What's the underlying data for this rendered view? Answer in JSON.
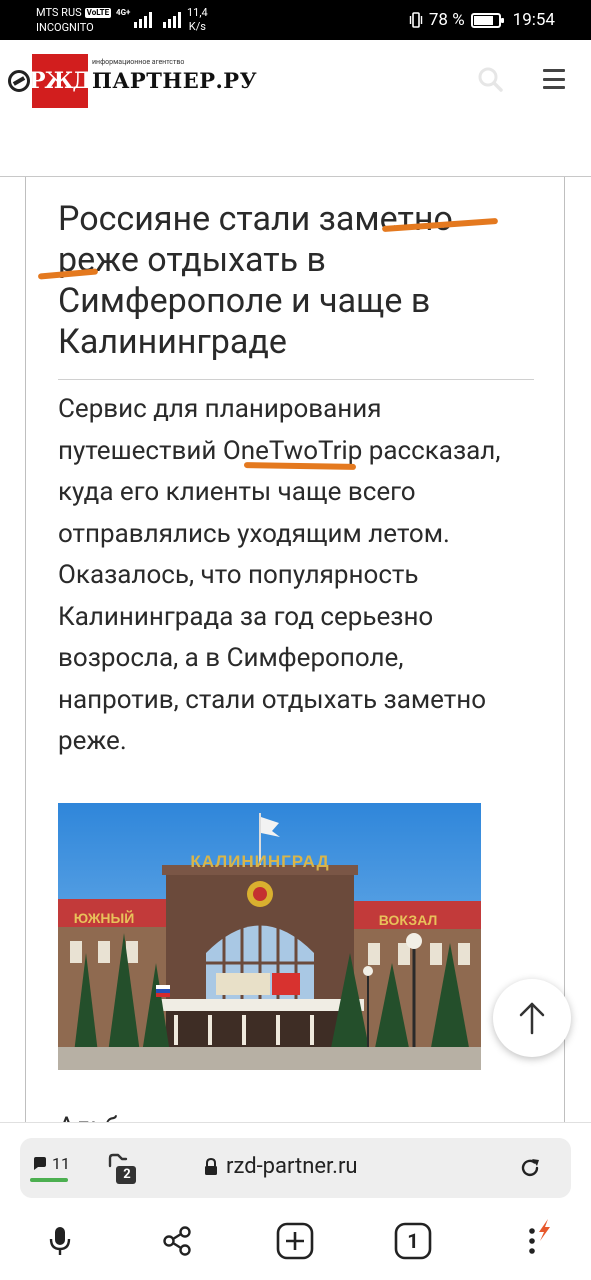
{
  "status_bar": {
    "carrier": "MTS RUS",
    "volte": "VoLTE",
    "mode": "INCOGNITO",
    "network": "4G+",
    "net_speed_value": "11,4",
    "net_speed_unit": "K/s",
    "battery_text": "78 %",
    "battery_level": 0.78,
    "time": "19:54"
  },
  "header": {
    "logo_brand": "РЖД",
    "logo_tagline": "информационное агентство",
    "logo_name": "ПАРТНЕР.РУ",
    "icons": [
      "search-icon",
      "menu-icon"
    ]
  },
  "article": {
    "title": "Россияне стали заметно реже отдыхать в Симферополе и чаще в Калининграде",
    "lead": "Сервис для планирования путешествий OneTwoTrip рассказал, куда его клиенты чаще всего отправлялись уходящим летом. Оказалось, что популярность Калининграда за год серьезно возросла, а в Симферополе, напротив, стали отдыхать заметно реже.",
    "photo": {
      "building_sign": "КАЛИНИНГРАД",
      "left_wing_sign": "ЮЖНЫЙ",
      "right_wing_sign": "ВОКЗАЛ"
    },
    "next_paragraph_start": "Альб"
  },
  "browser": {
    "comments_count": "11",
    "tabs_count": "2",
    "url": "rzd-partner.ru",
    "open_tabs": "1",
    "icons": [
      "comment-icon",
      "tabs-icon",
      "lock-icon",
      "reload-icon",
      "microphone-icon",
      "share-icon",
      "new-tab-icon",
      "tab-switcher-icon",
      "more-menu-icon"
    ]
  },
  "colors": {
    "brand_red": "#d21e1e",
    "annotation_orange": "#e4791f",
    "comments_accent": "#4caf50"
  }
}
